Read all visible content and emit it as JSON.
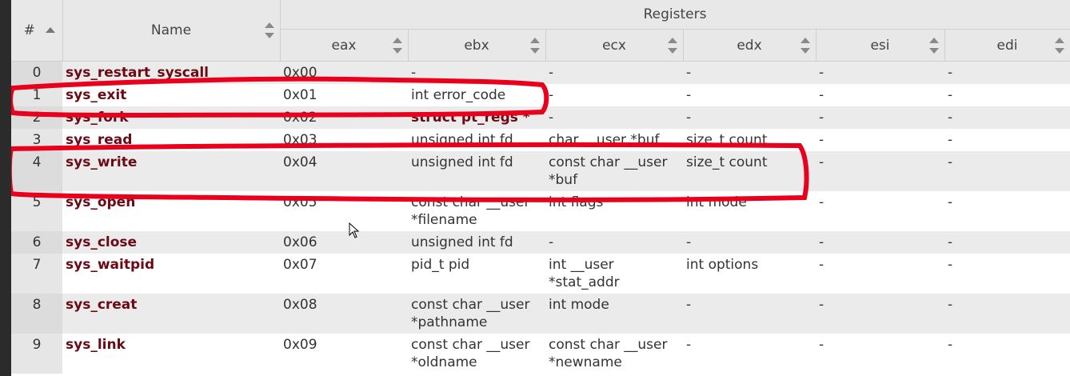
{
  "header": {
    "num_label": "#",
    "name_label": "Name",
    "group_label": "Registers",
    "registers": [
      "eax",
      "ebx",
      "ecx",
      "edx",
      "esi",
      "edi"
    ]
  },
  "rows": [
    {
      "num": "0",
      "name": "sys_restart_syscall",
      "eax": "0x00",
      "ebx": "-",
      "ecx": "-",
      "edx": "-",
      "esi": "-",
      "edi": "-"
    },
    {
      "num": "1",
      "name": "sys_exit",
      "eax": "0x01",
      "ebx": "int error_code",
      "ecx": "-",
      "edx": "-",
      "esi": "-",
      "edi": "-"
    },
    {
      "num": "2",
      "name": "sys_fork",
      "eax": "0x02",
      "ebx": "struct pt_regs *",
      "ecx": "-",
      "edx": "-",
      "esi": "-",
      "edi": "-"
    },
    {
      "num": "3",
      "name": "sys_read",
      "eax": "0x03",
      "ebx": "unsigned int fd",
      "ecx": "char __user *buf",
      "edx": "size_t count",
      "esi": "-",
      "edi": "-"
    },
    {
      "num": "4",
      "name": "sys_write",
      "eax": "0x04",
      "ebx": "unsigned int fd",
      "ecx": "const char __user *buf",
      "edx": "size_t count",
      "esi": "-",
      "edi": "-"
    },
    {
      "num": "5",
      "name": "sys_open",
      "eax": "0x05",
      "ebx": "const char __user *filename",
      "ecx": "int flags",
      "edx": "int mode",
      "esi": "-",
      "edi": "-"
    },
    {
      "num": "6",
      "name": "sys_close",
      "eax": "0x06",
      "ebx": "unsigned int fd",
      "ecx": "-",
      "edx": "-",
      "esi": "-",
      "edi": "-"
    },
    {
      "num": "7",
      "name": "sys_waitpid",
      "eax": "0x07",
      "ebx": "pid_t pid",
      "ecx": "int __user *stat_addr",
      "edx": "int options",
      "esi": "-",
      "edi": "-"
    },
    {
      "num": "8",
      "name": "sys_creat",
      "eax": "0x08",
      "ebx": "const char __user *pathname",
      "ecx": "int mode",
      "edx": "-",
      "esi": "-",
      "edi": "-"
    },
    {
      "num": "9",
      "name": "sys_link",
      "eax": "0x09",
      "ebx": "const char __user *oldname",
      "ecx": "const char __user *newname",
      "edx": "-",
      "esi": "-",
      "edi": "-"
    }
  ],
  "colors": {
    "name_text": "#6b0a14",
    "annotation": "#e8001c",
    "header_bg": "#e8e8e8"
  },
  "icons": [
    "sort-ascending-icon",
    "sort-toggle-icon",
    "mouse-cursor-icon"
  ]
}
